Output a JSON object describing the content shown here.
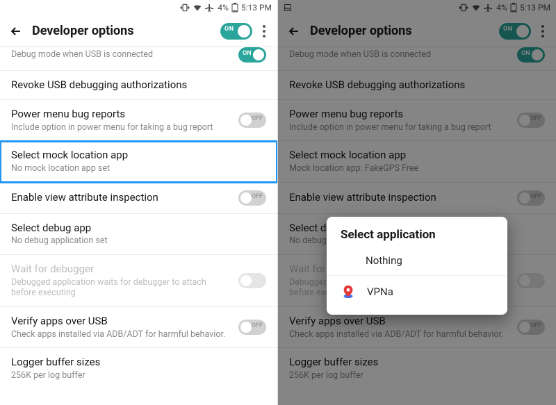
{
  "status": {
    "battery": "4%",
    "time": "5:13 PM"
  },
  "toolbar": {
    "title": "Developer options",
    "master_on": "ON"
  },
  "left": {
    "usb_debug_sub": "Debug mode when USB is connected",
    "revoke": "Revoke USB debugging authorizations",
    "bug_title": "Power menu bug reports",
    "bug_sub": "Include option in power menu for taking a bug report",
    "mock_title": "Select mock location app",
    "mock_sub": "No mock location app set",
    "attr_title": "Enable view attribute inspection",
    "debugapp_title": "Select debug app",
    "debugapp_sub": "No debug application set",
    "wait_title": "Wait for debugger",
    "wait_sub": "Debugged application waits for debugger to attach before executing",
    "verify_title": "Verify apps over USB",
    "verify_sub": "Check apps installed via ADB/ADT for harmful behavior.",
    "logger_title": "Logger buffer sizes",
    "logger_sub": "256K per log buffer",
    "on_label": "ON",
    "off_label": "OFF"
  },
  "right": {
    "mock_sub": "Mock location app: FakeGPS Free"
  },
  "dialog": {
    "title": "Select application",
    "item_nothing": "Nothing",
    "item_vpna": "VPNa"
  }
}
